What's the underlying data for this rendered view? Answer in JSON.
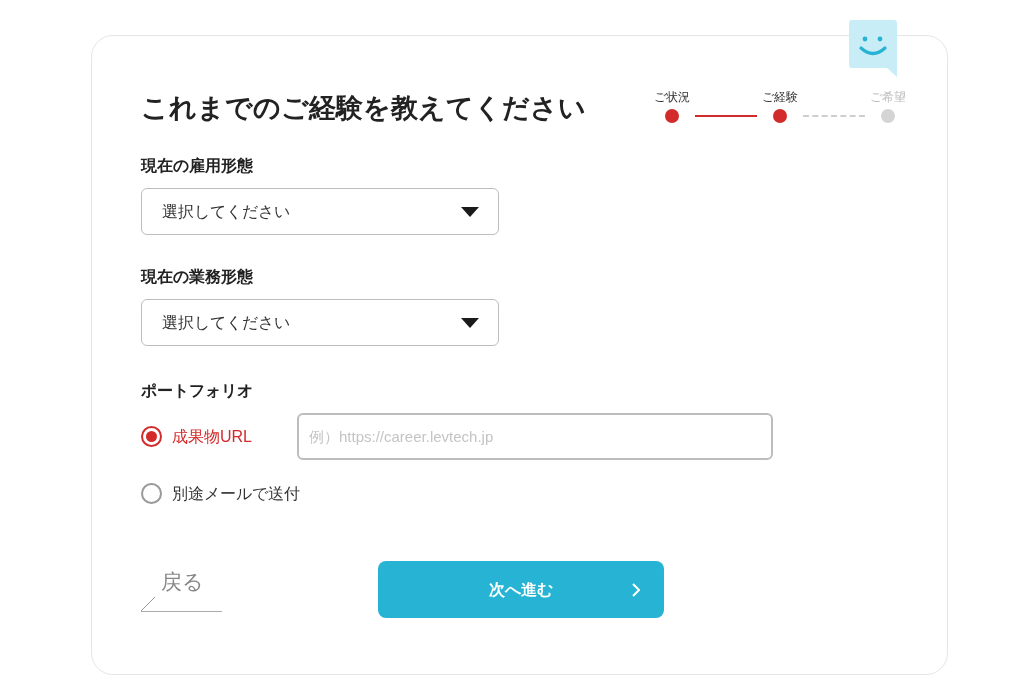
{
  "title": "これまでのご経験を教えてください",
  "steps": [
    {
      "label": "ご状況",
      "completed": true
    },
    {
      "label": "ご経験",
      "completed": true
    },
    {
      "label": "ご希望",
      "completed": false
    }
  ],
  "fields": [
    {
      "label": "現在の雇用形態",
      "placeholder": "選択してください"
    },
    {
      "label": "現在の業務形態",
      "placeholder": "選択してください"
    }
  ],
  "portfolio": {
    "label": "ポートフォリオ",
    "options": [
      {
        "label": "成果物URL",
        "selected": true,
        "placeholder": "例）https://career.levtech.jp"
      },
      {
        "label": "別途メールで送付",
        "selected": false
      }
    ]
  },
  "back_button": "戻る",
  "next_button": "次へ進む"
}
